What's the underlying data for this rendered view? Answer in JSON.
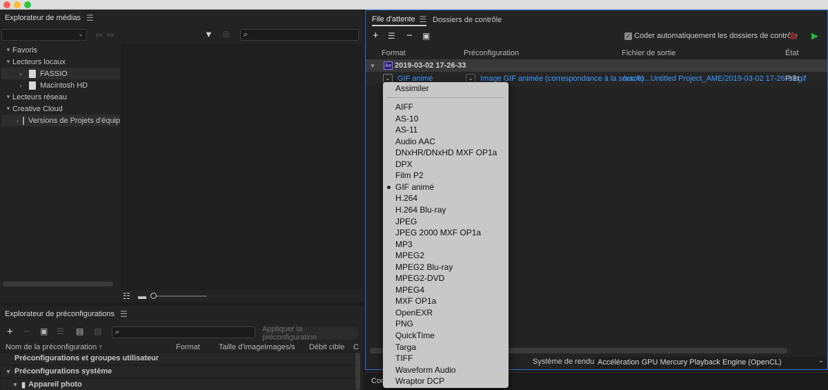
{
  "media_browser": {
    "title": "Explorateur de médias",
    "tree": [
      {
        "label": "Favoris",
        "level": 0,
        "chevron": "▾"
      },
      {
        "label": "Lecteurs locaux",
        "level": 0,
        "chevron": "▾"
      },
      {
        "label": "FASSIO",
        "level": 1,
        "chevron": "›",
        "icon": "drive-icon"
      },
      {
        "label": "Macintosh HD",
        "level": 1,
        "chevron": "›",
        "icon": "drive-icon"
      },
      {
        "label": "Lecteurs réseau",
        "level": 0,
        "chevron": "▾"
      },
      {
        "label": "Creative Cloud",
        "level": 0,
        "chevron": "▾"
      },
      {
        "label": "Versions de Projets d'équip",
        "level": 1,
        "chevron": "›",
        "icon": "team-projects-icon"
      }
    ]
  },
  "preset_browser": {
    "title": "Explorateur de préconfigurations",
    "apply_label": "Appliquer la préconfiguration",
    "columns": [
      "Nom de la préconfiguration ↑",
      "Format",
      "Taille d'image",
      "Images/s",
      "Débit cible",
      "C"
    ],
    "rows": [
      {
        "label": "Préconfigurations et groupes utilisateur",
        "chevron": ""
      },
      {
        "label": "Préconfigurations système",
        "chevron": "▾"
      },
      {
        "label": "Appareil photo",
        "chevron": "▾"
      }
    ]
  },
  "queue": {
    "tabs": [
      "File d'attente",
      "Dossiers de contrôle"
    ],
    "auto_encode_label": "Coder automatiquement les dossiers de contrôle",
    "columns": [
      "Format",
      "Préconfiguration",
      "Fichier de sortie",
      "État"
    ],
    "group": {
      "badge": "Ae",
      "title": "2019-03-02 17-26-33"
    },
    "item": {
      "format": "GIF animé",
      "preset": "Image GIF animée (correspondance à la source)",
      "output": "/var/fo...Untitled Project_AME/2019-03-02 17-26-33.gif",
      "status": "Prêt"
    },
    "renderer_label": "Système de rendu :",
    "renderer_value": "Accélération GPU Mercury Playback Engine (OpenCL)",
    "bottom_label": "Cod"
  },
  "format_menu": {
    "first": "Assimiler",
    "items": [
      "AIFF",
      "AS-10",
      "AS-11",
      "Audio AAC",
      "DNxHR/DNxHD MXF OP1a",
      "DPX",
      "Film P2",
      "GIF animé",
      "H.264",
      "H.264 Blu-ray",
      "JPEG",
      "JPEG 2000 MXF OP1a",
      "MP3",
      "MPEG2",
      "MPEG2 Blu-ray",
      "MPEG2-DVD",
      "MPEG4",
      "MXF OP1a",
      "OpenEXR",
      "PNG",
      "QuickTime",
      "Targa",
      "TIFF",
      "Waveform Audio",
      "Wraptor DCP"
    ],
    "selected": "GIF animé"
  }
}
